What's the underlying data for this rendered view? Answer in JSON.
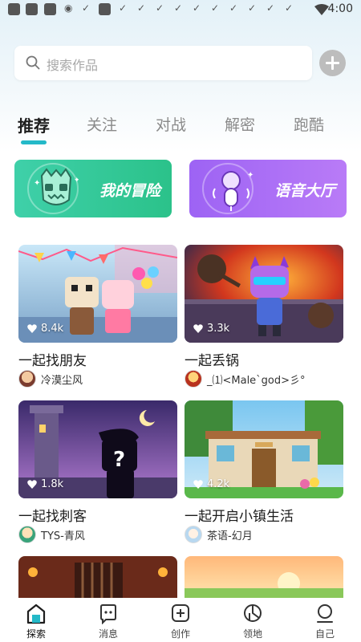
{
  "status_bar": {
    "time": "4:00"
  },
  "search": {
    "placeholder": "搜索作品"
  },
  "tabs": [
    {
      "label": "推荐",
      "active": true
    },
    {
      "label": "关注",
      "active": false
    },
    {
      "label": "对战",
      "active": false
    },
    {
      "label": "解密",
      "active": false
    },
    {
      "label": "跑酷",
      "active": false
    }
  ],
  "banners": [
    {
      "label": "我的冒险",
      "icon": "monster-icon"
    },
    {
      "label": "语音大厅",
      "icon": "microphone-icon"
    }
  ],
  "cards": [
    {
      "title": "一起找朋友",
      "likes": "8.4k",
      "author": "冷漠尘风"
    },
    {
      "title": "一起丢锅",
      "likes": "3.3k",
      "author": "_⑴<Male`god>彡°"
    },
    {
      "title": "一起找刺客",
      "likes": "1.8k",
      "author": "TYS-青风"
    },
    {
      "title": "一起开启小镇生活",
      "likes": "4.2k",
      "author": "茶语-幻月"
    }
  ],
  "bottom_nav": [
    {
      "label": "探索",
      "icon": "explore-icon",
      "active": true
    },
    {
      "label": "消息",
      "icon": "message-icon",
      "active": false
    },
    {
      "label": "创作",
      "icon": "create-icon",
      "active": false
    },
    {
      "label": "领地",
      "icon": "territory-icon",
      "active": false
    },
    {
      "label": "自己",
      "icon": "profile-icon",
      "active": false
    }
  ],
  "colors": {
    "accent": "#24b9c8",
    "banner_green": "#2bc28a",
    "banner_purple": "#9d63f4"
  }
}
